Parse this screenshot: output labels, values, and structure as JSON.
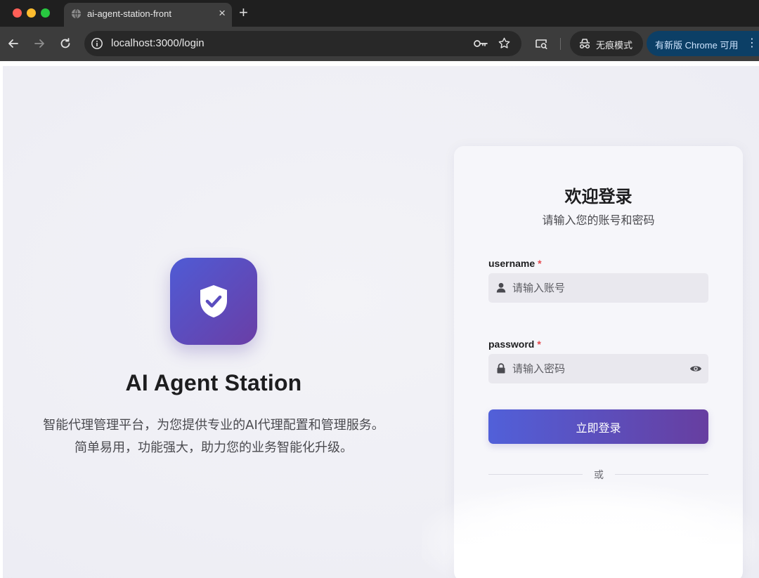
{
  "browser": {
    "tab": {
      "title": "ai-agent-station-front",
      "favicon": "globe-icon"
    },
    "new_tab_label": "+",
    "close_tab_label": "×",
    "url": "localhost:3000/login",
    "incognito_label": "无痕模式",
    "update_label": "有新版 Chrome 可用",
    "menu_label": "⋮",
    "icons": [
      "back-arrow-icon",
      "forward-arrow-icon",
      "reload-icon",
      "site-info-icon",
      "key-icon",
      "star-icon",
      "tab-search-icon",
      "incognito-icon"
    ]
  },
  "brand": {
    "logo_icon": "shield-check-icon",
    "title": "AI Agent Station",
    "description_line1": "智能代理管理平台，为您提供专业的AI代理配置和管理服务。",
    "description_line2": "简单易用，功能强大，助力您的业务智能化升级。"
  },
  "login": {
    "title": "欢迎登录",
    "subtitle": "请输入您的账号和密码",
    "username": {
      "label": "username",
      "required_mark": "*",
      "placeholder": "请输入账号",
      "value": ""
    },
    "password": {
      "label": "password",
      "required_mark": "*",
      "placeholder": "请输入密码",
      "value": ""
    },
    "submit_label": "立即登录",
    "divider_text": "或"
  },
  "colors": {
    "accent_start": "#5160d9",
    "accent_end": "#673ea0",
    "required": "#e5484d"
  }
}
